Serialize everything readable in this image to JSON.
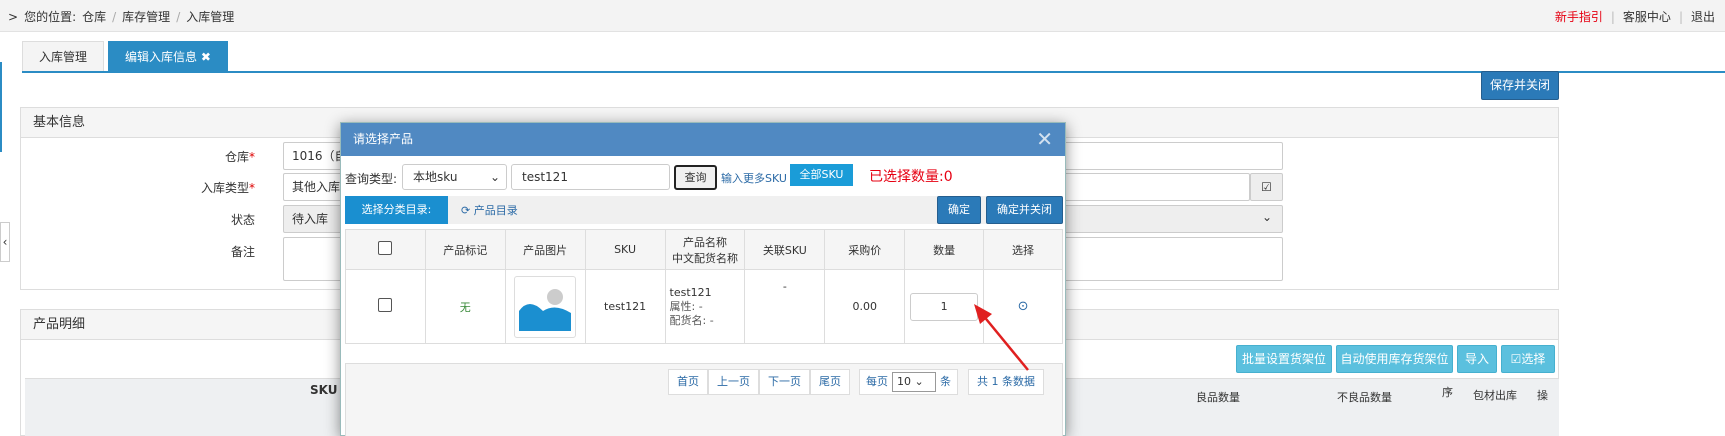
{
  "breadcrumb": {
    "prefix": "您的位置:",
    "items": [
      "仓库",
      "库存管理",
      "入库管理"
    ]
  },
  "top_links": {
    "guide": "新手指引",
    "service": "客服中心",
    "logout": "退出",
    "guide_color": "#e60012"
  },
  "tabs": [
    {
      "label": "入库管理"
    },
    {
      "label": "编辑入库信息 ✖"
    }
  ],
  "toolbar": {
    "save_close": "保存并关闭"
  },
  "basic_info": {
    "title": "基本信息",
    "warehouse_label": "仓库",
    "warehouse_value": "1016（自",
    "type_label": "入库类型",
    "type_value": "其他入库",
    "status_label": "状态",
    "status_value": "待入库",
    "note_label": "备注",
    "required_mark": "*"
  },
  "product_detail": {
    "title": "产品明细",
    "buttons": {
      "batch": "批量设置货架位",
      "auto": "自动使用库存货架位",
      "import": "导入",
      "select": "☑选择"
    },
    "columns": {
      "sku": "SKU",
      "c2": "良品数量",
      "c3": "不良品数量",
      "c4": "序",
      "c5": "包材出库",
      "c6": "操"
    }
  },
  "modal": {
    "title": "请选择产品",
    "query_label": "查询类型:",
    "query_type": "本地sku",
    "query_value": "test121",
    "query_btn": "查询",
    "more_sku": "输入更多SKU",
    "all_sku": "全部SKU",
    "selected_count": "已选择数量:0",
    "category_label": "选择分类目录:",
    "product_dir": "产品目录",
    "confirm": "确定",
    "confirm_close": "确定并关闭",
    "columns": {
      "mark": "产品标记",
      "image": "产品图片",
      "sku": "SKU",
      "name1": "产品名称",
      "name2": "中文配货名称",
      "related": "关联SKU",
      "price": "采购价",
      "qty": "数量",
      "choose": "选择"
    },
    "rows": [
      {
        "mark": "无",
        "sku": "test121",
        "name": "test121",
        "attr": "属性: -",
        "alloc": "配货名: -",
        "related": "-",
        "price": "0.00",
        "qty": "1"
      }
    ],
    "pager": {
      "first": "首页",
      "prev": "上一页",
      "next": "下一页",
      "last": "尾页",
      "per_page": "每页",
      "size": "10",
      "unit": "条",
      "total": "共 1 条数据"
    }
  }
}
